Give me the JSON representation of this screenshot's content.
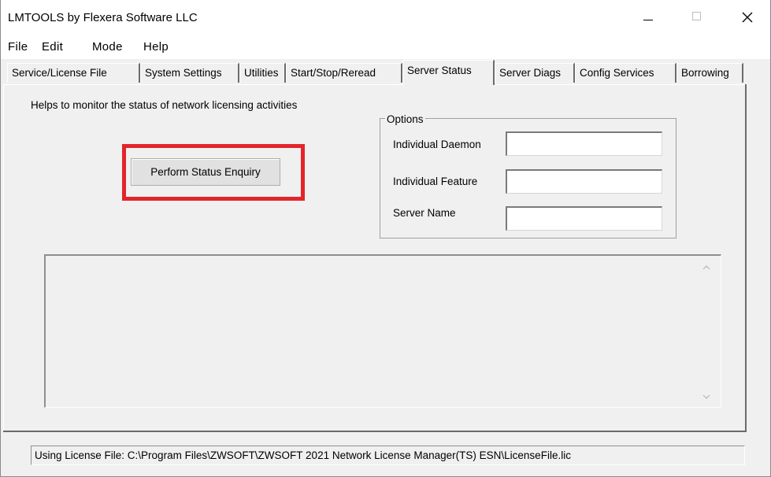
{
  "window": {
    "title": "LMTOOLS by Flexera Software LLC",
    "minimize_glyph": "—",
    "maximize_glyph": "☐",
    "close_glyph": "✕"
  },
  "menu": [
    "File",
    "Edit",
    "Mode",
    "Help"
  ],
  "tabs": [
    {
      "label": "Service/License File",
      "active": false
    },
    {
      "label": "System Settings",
      "active": false
    },
    {
      "label": "Utilities",
      "active": false
    },
    {
      "label": "Start/Stop/Reread",
      "active": false
    },
    {
      "label": "Server Status",
      "active": true
    },
    {
      "label": "Server Diags",
      "active": false
    },
    {
      "label": "Config Services",
      "active": false
    },
    {
      "label": "Borrowing",
      "active": false
    }
  ],
  "server_status": {
    "help_text": "Helps to monitor the status of network licensing activities",
    "enquiry_button": "Perform Status Enquiry",
    "options": {
      "legend": "Options",
      "individual_daemon_label": "Individual Daemon",
      "individual_daemon_value": "",
      "individual_feature_label": "Individual Feature",
      "individual_feature_value": "",
      "server_name_label": "Server Name",
      "server_name_value": ""
    },
    "output_text": ""
  },
  "status_bar": {
    "text": "Using License File:  C:\\Program Files\\ZWSOFT\\ZWSOFT 2021 Network License Manager(TS) ESN\\LicenseFile.lic"
  },
  "colors": {
    "highlight": "#e3242b",
    "dialog_background": "#f0f0f0"
  }
}
